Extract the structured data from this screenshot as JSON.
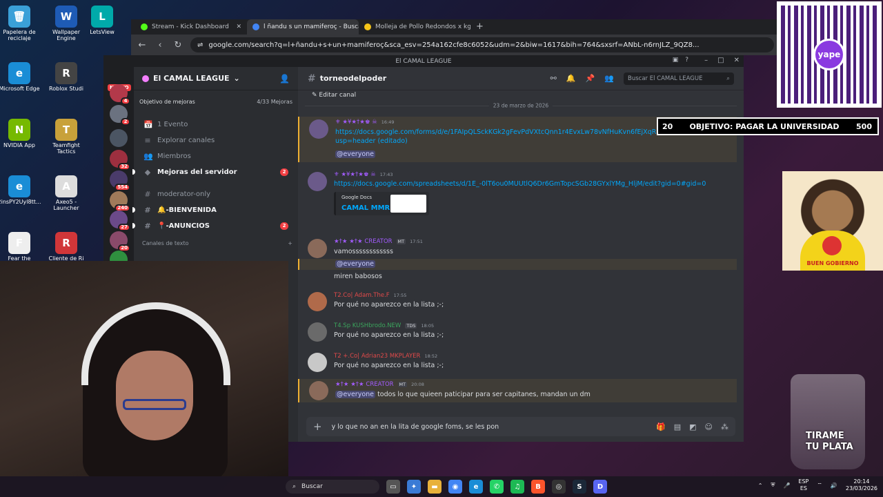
{
  "desktop_icons": [
    {
      "label": "Papelera de reciclaje",
      "color": "#3aa0d8",
      "glyph": "🗑"
    },
    {
      "label": "Wallpaper Engine",
      "color": "#1e5bb5",
      "glyph": "W"
    },
    {
      "label": "LetsView",
      "color": "#0aa",
      "glyph": "L"
    },
    {
      "label": "Microsoft Edge",
      "color": "#1a8dd6",
      "glyph": "e"
    },
    {
      "label": "Roblox Studi",
      "color": "#444",
      "glyph": "R"
    },
    {
      "label": "NVIDIA App",
      "color": "#76b900",
      "glyph": "N"
    },
    {
      "label": "Teamfight Tactics",
      "color": "#c8a13a",
      "glyph": "T"
    },
    {
      "label": "2insPY2Uyl8tt...",
      "color": "#1a8dd6",
      "glyph": "e"
    },
    {
      "label": "Axeo5 - Launcher",
      "color": "#ddd",
      "glyph": "A"
    },
    {
      "label": "Fear the",
      "color": "#eee",
      "glyph": "F"
    },
    {
      "label": "Cliente de Ri",
      "color": "#d13639",
      "glyph": "R"
    }
  ],
  "browser": {
    "tabs": [
      {
        "label": "Stream - Kick Dashboard",
        "color": "#53fc18"
      },
      {
        "label": "l ñandu s un mamiferoç - Buscar",
        "color": "#4285f4"
      },
      {
        "label": "Molleja de Pollo Redondos x kg - Me",
        "color": "#f5c518"
      }
    ],
    "active_tab": 1,
    "url": "google.com/search?q=l+ñandu+s+un+mamiferoç&sca_esv=254a162cfe8c6052&udm=2&biw=1617&bih=764&sxsrf=ANbL-n6rnJLZ_9QZ8..."
  },
  "discord": {
    "window_title": "El CAMAL LEAGUE",
    "server_name": "El CAMAL LEAGUE",
    "nuevo_label": "NUEVO",
    "server_badges": [
      "4",
      "2",
      "32",
      "554",
      "240",
      "27",
      "20"
    ],
    "boost_label": "Objetivo de mejoras",
    "boost_count": "4/33 Mejoras",
    "channels": [
      {
        "label": "1 Evento",
        "icon": "📅",
        "bold": false,
        "badge": ""
      },
      {
        "label": "Explorar canales",
        "icon": "≡",
        "bold": false,
        "badge": ""
      },
      {
        "label": "Miembros",
        "icon": "👥",
        "bold": false,
        "badge": ""
      },
      {
        "label": "Mejoras del servidor",
        "icon": "◆",
        "bold": true,
        "badge": "2"
      },
      {
        "label": "moderator-only",
        "icon": "#",
        "bold": false,
        "badge": ""
      },
      {
        "label": "🔔-BIENVENIDA",
        "icon": "#",
        "bold": true,
        "badge": ""
      },
      {
        "label": "📍-ANUNCIOS",
        "icon": "#",
        "bold": true,
        "badge": "2"
      }
    ],
    "category_label": "Canales de texto",
    "channel_name": "torneodelpoder",
    "search_placeholder": "Buscar El CAMAL LEAGUE",
    "edit_channel": "Editar canal",
    "date_divider": "23 de marzo de 2026",
    "messages": [
      {
        "author": "⚜ ★¥★†★♚ ☠",
        "time": "16:49",
        "lines": [
          "https://docs.google.com/forms/d/e/1FAIpQLSckKGk2gFevPdVXtcQnn1r4EvxLw78vNfHuKvn6fEjXqRndg.../viewform?",
          "usp=header (editado)",
          "@everyone"
        ]
      },
      {
        "author": "⚜ ★¥★†★♚ ☠",
        "time": "17:43",
        "lines": [
          "https://docs.google.com/spreadsheets/d/1E_-0lT6ou0MUUtlQ6Dr6GmTopcSGb28GYxlYMg_HljM/edit?gid=0#gid=0"
        ],
        "embed": {
          "provider": "Google Docs",
          "title": "CAMAL MMR"
        }
      },
      {
        "author": "★†★ ★†★ CREATOR",
        "tag": "MT",
        "time": "17:51",
        "lines": [
          "vamossssssssssss",
          "@everyone",
          "miren babosos"
        ]
      },
      {
        "author": "T2.Co| Adam.The.F",
        "time": "17:55",
        "lines": [
          "Por qué no aparezco en la lista ;-;"
        ]
      },
      {
        "author": "T4.Sp KUSHbrodo.NEW",
        "tag": "TDS",
        "time": "18:05",
        "lines": [
          "Por qué no aparezco en la lista ;-;"
        ]
      },
      {
        "author": "T2 +.Co| Adrian23 MKPLAYER",
        "time": "18:52",
        "lines": [
          "Por qué no aparezco en la lista ;-;"
        ]
      },
      {
        "author": "★†★ ★†★ CREATOR",
        "tag": "MT",
        "time": "20:08",
        "lines": [
          "@everyone",
          "todos lo que quieen paticipar para ser capitanes, mandan un dm"
        ]
      }
    ],
    "composer_text": "y lo que no an en la lita de google foms, se les pon"
  },
  "overlays": {
    "qr_label": "yape",
    "goal_current": "20",
    "goal_title": "OBJETIVO: PAGAR LA UNIVERSIDAD",
    "goal_target": "500",
    "shirt_text": "BUEN GOBIERNO",
    "cup_line1": "TIRAME",
    "cup_line2": "TU PLATA"
  },
  "taskbar": {
    "search_placeholder": "Buscar",
    "lang_line1": "ESP",
    "lang_line2": "ES",
    "time": "20:14",
    "date": "23/03/2026"
  }
}
